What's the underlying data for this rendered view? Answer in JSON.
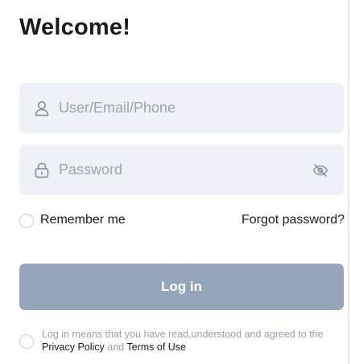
{
  "header": {
    "title": "Welcome!"
  },
  "form": {
    "username": {
      "placeholder": "User/Email/Phone",
      "icon": "user-icon"
    },
    "password": {
      "placeholder": "Password",
      "icon": "lock-icon",
      "toggle_icon": "eye-off-icon"
    },
    "remember_label": "Remember me",
    "forgot_label": "Forgot password?",
    "login_label": "Log in"
  },
  "agreement": {
    "prefix": "Log in means that you have read,understood and agreed to the",
    "privacy_link": "Privacy Policy",
    "conjunction": " and ",
    "terms_link": "Terms of Use"
  },
  "colors": {
    "field_background": "#eef1f7",
    "button_background": "#97a5ba",
    "placeholder": "#9aa3b4",
    "text_primary": "#1b1b1f",
    "text_muted": "#9aa1ad"
  }
}
